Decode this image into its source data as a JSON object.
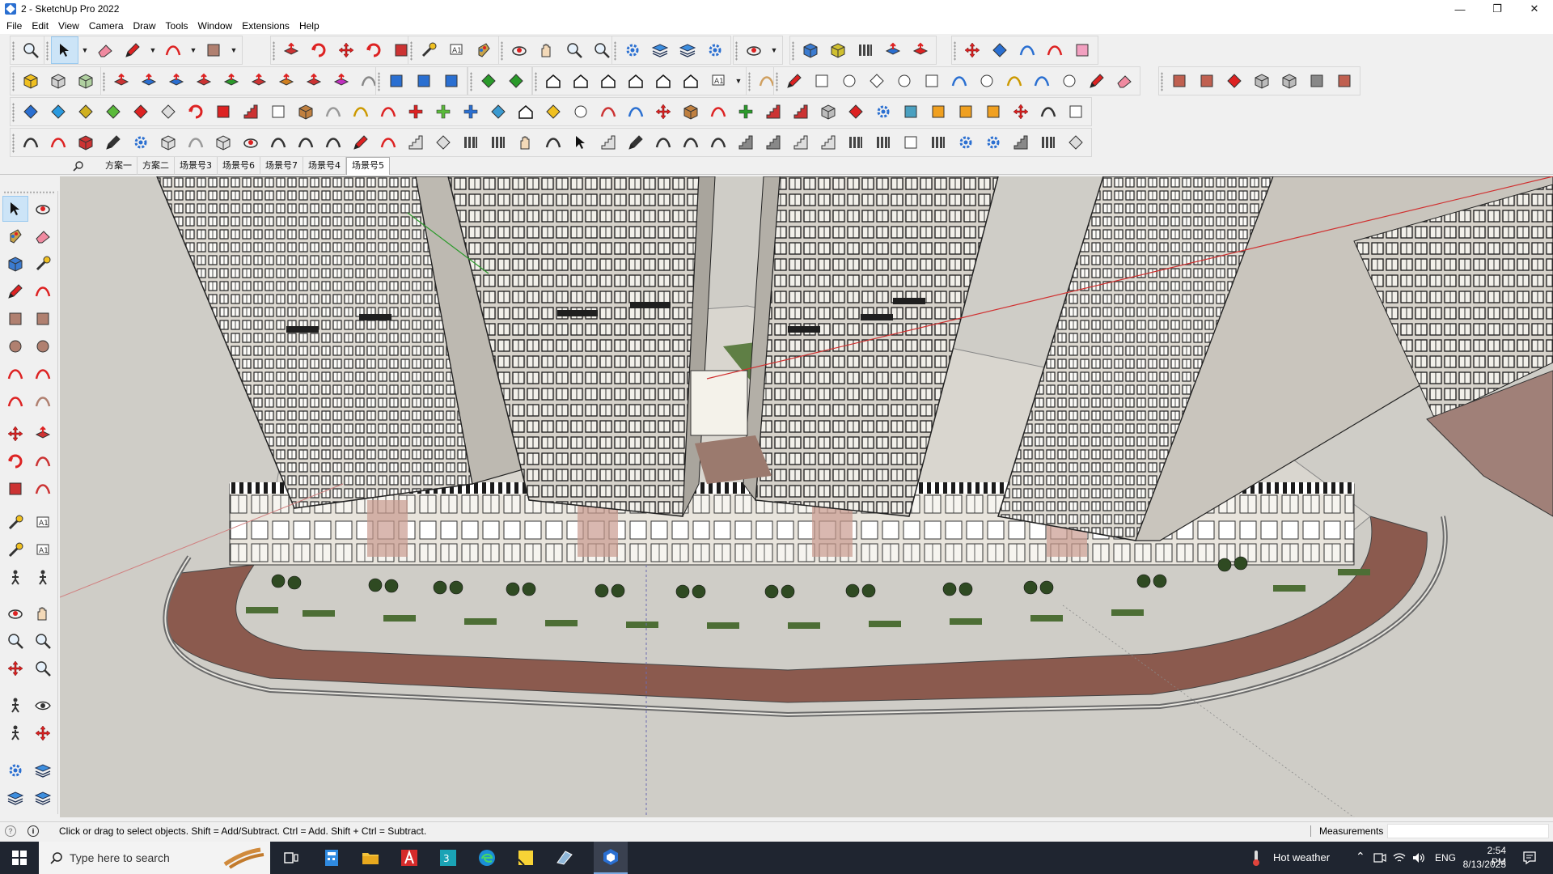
{
  "window": {
    "title": "2 - SketchUp Pro 2022",
    "controls": [
      "minimize-icon",
      "restore-icon",
      "close-icon"
    ]
  },
  "menu": [
    "File",
    "Edit",
    "View",
    "Camera",
    "Draw",
    "Tools",
    "Window",
    "Extensions",
    "Help"
  ],
  "scenes": {
    "tabs": [
      "方案一",
      "方案二",
      "场景号3",
      "场景号6",
      "场景号7",
      "场景号4",
      "场景号5"
    ],
    "active_index": 6
  },
  "status": {
    "message": "Click or drag to select objects. Shift = Add/Subtract. Ctrl = Add. Shift + Ctrl = Subtract.",
    "measurements_label": "Measurements",
    "measurements_value": ""
  },
  "taskbar": {
    "search_placeholder": "Type here to search",
    "weather": "Hot weather",
    "language": "ENG",
    "time": "2:54 PM",
    "date": "8/13/2023"
  },
  "colors": {
    "viewport_bg": "#cfcdc7",
    "selection_highlight": "#cce4f7",
    "taskbar_bg": "#1f2530",
    "axis_red": "#d03030",
    "axis_green": "#2a9a2a"
  }
}
